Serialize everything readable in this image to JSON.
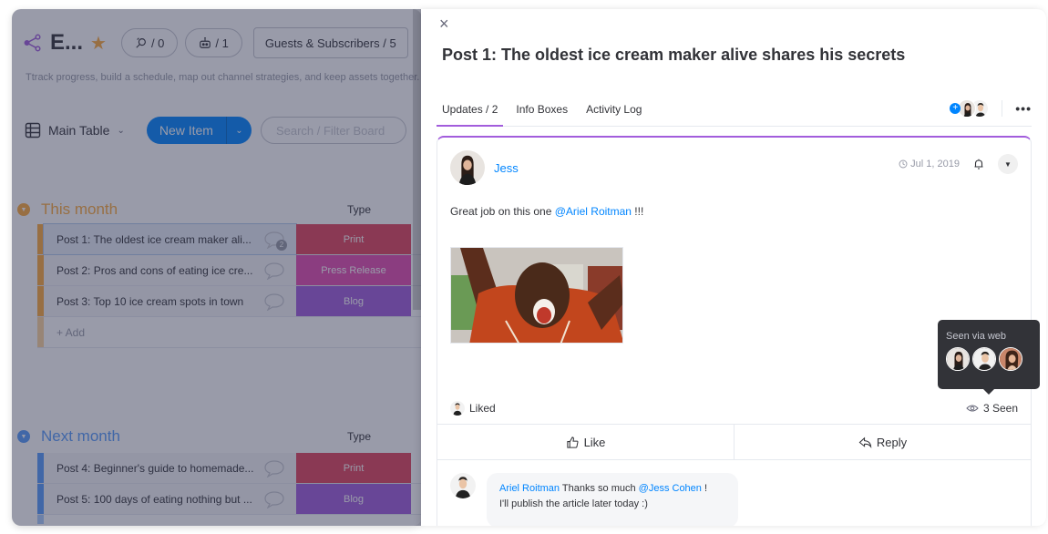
{
  "board": {
    "title": "E...",
    "activity_count": "/ 0",
    "automation_count": "/ 1",
    "guests_label": "Guests & Subscribers / 5",
    "description": "Ttrack progress, build a schedule, map out channel strategies, and keep assets together.",
    "view_label": "Main Table",
    "new_item_label": "New Item",
    "search_placeholder": "Search / Filter Board",
    "icons": {
      "share": "share-icon",
      "star": "star-icon",
      "activity": "activity-search-icon",
      "automation": "robot-icon",
      "table": "table-icon"
    },
    "groups": [
      {
        "title": "This month",
        "color": "#fdab3d",
        "column_header": "Type",
        "rows": [
          {
            "name": "Post 1: The oldest ice cream maker ali...",
            "type": "Print",
            "type_color": "#e2445c",
            "comments": "2",
            "selected": true
          },
          {
            "name": "Post 2: Pros and cons of eating ice cre...",
            "type": "Press Release",
            "type_color": "#e44bb0",
            "comments": ""
          },
          {
            "name": "Post 3: Top 10 ice cream spots in town",
            "type": "Blog",
            "type_color": "#a25ddc",
            "comments": ""
          }
        ],
        "add_label": "+ Add"
      },
      {
        "title": "Next month",
        "color": "#579bfc",
        "column_header": "Type",
        "rows": [
          {
            "name": "Post 4: Beginner's guide to homemade...",
            "type": "Print",
            "type_color": "#e2445c",
            "comments": ""
          },
          {
            "name": "Post 5: 100 days of eating nothing but ...",
            "type": "Blog",
            "type_color": "#a25ddc",
            "comments": ""
          }
        ]
      }
    ]
  },
  "item_panel": {
    "title": "Post 1: The oldest ice cream maker alive shares his secrets",
    "tabs": [
      {
        "label": "Updates / 2",
        "active": true
      },
      {
        "label": "Info Boxes",
        "active": false
      },
      {
        "label": "Activity Log",
        "active": false
      }
    ],
    "more_label": "•••",
    "close_label": "×",
    "update": {
      "author": "Jess",
      "date": "Jul 1, 2019",
      "body_prefix": "Great job on this one ",
      "mention": "@Ariel Roitman",
      "body_suffix": " !!!",
      "liked_label": "Liked",
      "seen_label": "3 Seen",
      "seen_tooltip": "Seen via web",
      "like_button": "Like",
      "reply_button": "Reply",
      "reply": {
        "author": "Ariel Roitman",
        "text_prefix": " Thanks so much ",
        "mention": "@Jess Cohen",
        "text_suffix": " !",
        "line2": "I'll publish the article later today :)"
      }
    }
  },
  "colors": {
    "accent": "#a25ddc",
    "primary": "#0085ff",
    "print": "#e2445c",
    "press_release": "#e44bb0",
    "blog": "#a25ddc"
  }
}
